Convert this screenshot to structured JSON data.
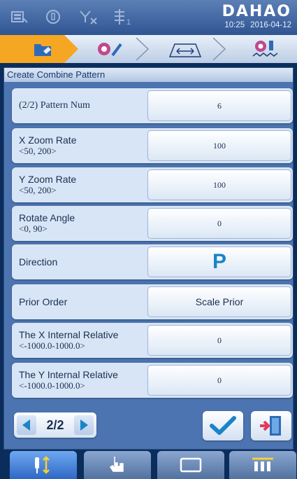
{
  "status": {
    "brand": "DAHAO",
    "time": "10:25",
    "date": "2016-04-12",
    "icons": [
      "machine-icon",
      "needle-icon",
      "signal-off-icon",
      "head-count-icon"
    ],
    "head_count": "1"
  },
  "modes": [
    "folder-mode-icon",
    "design-edit-mode-icon",
    "frame-move-mode-icon",
    "embroider-mode-icon"
  ],
  "panel": {
    "title": "Create Combine Pattern",
    "rows": [
      {
        "label": "(2/2) Pattern Num",
        "range": "",
        "value": "6"
      },
      {
        "label": "X Zoom Rate",
        "range": "<50, 200>",
        "value": "100"
      },
      {
        "label": "Y Zoom Rate",
        "range": "<50, 200>",
        "value": "100"
      },
      {
        "label": "Rotate Angle",
        "range": "<0, 90>",
        "value": "0"
      },
      {
        "label": "Direction",
        "range": "",
        "value": "P"
      },
      {
        "label": "Prior Order",
        "range": "",
        "value": "Scale Prior"
      },
      {
        "label": "The X Internal Relative",
        "range": "<-1000.0-1000.0>",
        "value": "0"
      },
      {
        "label": "The Y Internal Relative",
        "range": "<-1000.0-1000.0>",
        "value": "0"
      }
    ]
  },
  "pager": {
    "label": "2/2"
  },
  "actions": {
    "confirm": "checkmark-icon",
    "exit": "exit-door-icon"
  },
  "nav": [
    "needle-mode-icon",
    "touch-hand-icon",
    "frame-icon",
    "needle-bar-icon"
  ],
  "colors": {
    "accent": "#1a84c8",
    "active_mode": "#f5a623",
    "exit": "#e23b5a"
  }
}
